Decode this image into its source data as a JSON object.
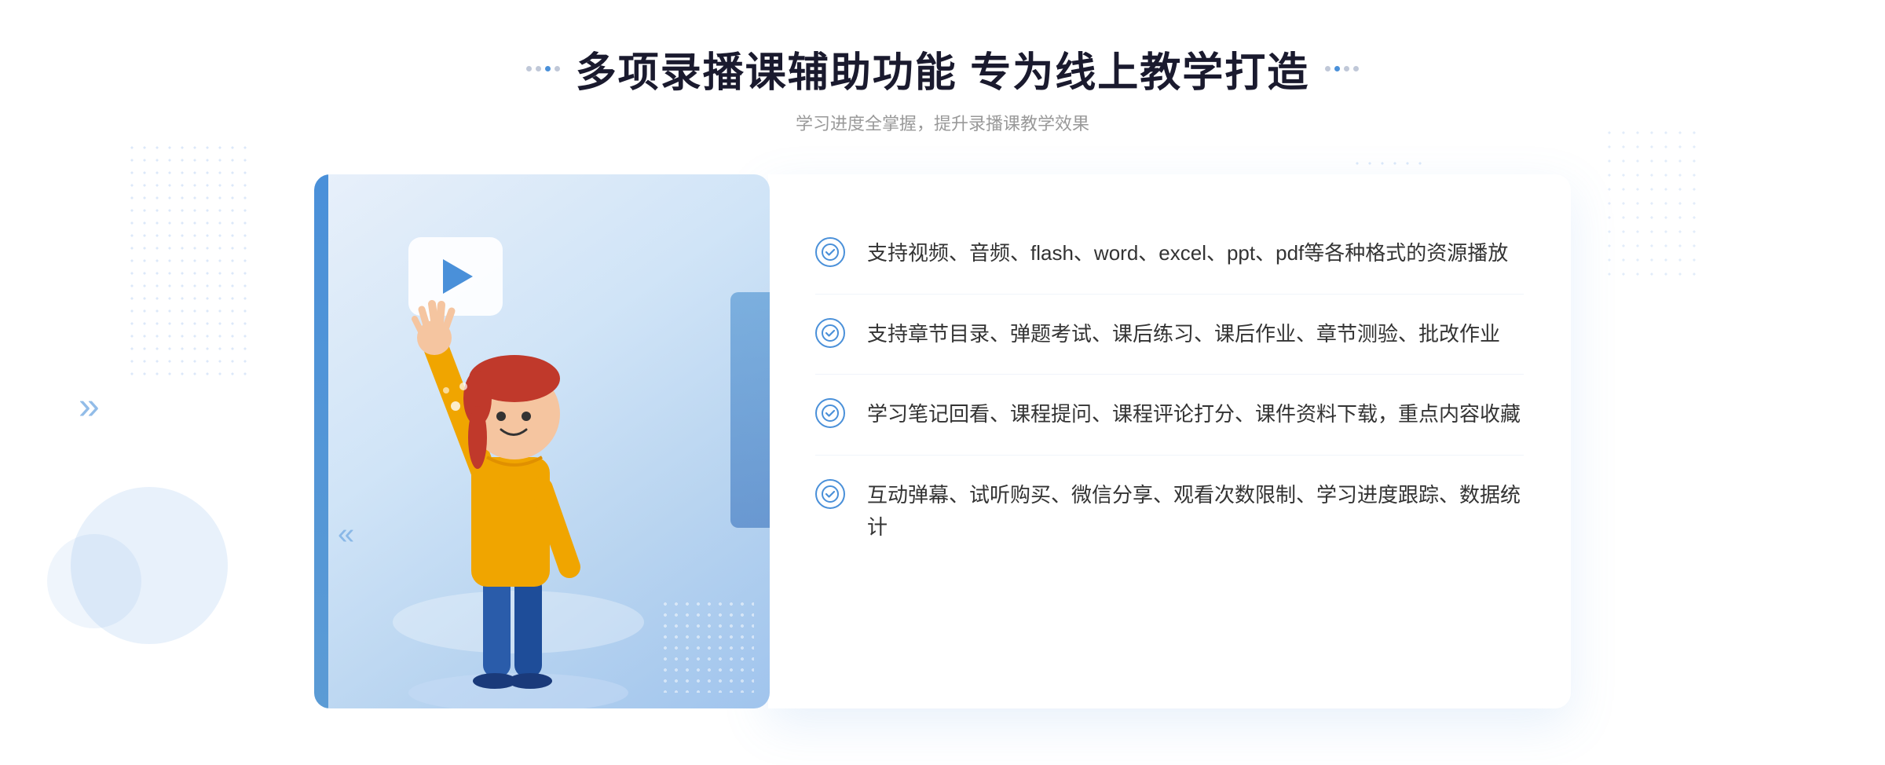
{
  "header": {
    "main_title": "多项录播课辅助功能 专为线上教学打造",
    "sub_title": "学习进度全掌握，提升录播课教学效果"
  },
  "features": [
    {
      "id": 1,
      "text": "支持视频、音频、flash、word、excel、ppt、pdf等各种格式的资源播放"
    },
    {
      "id": 2,
      "text": "支持章节目录、弹题考试、课后练习、课后作业、章节测验、批改作业"
    },
    {
      "id": 3,
      "text": "学习笔记回看、课程提问、课程评论打分、课件资料下载，重点内容收藏"
    },
    {
      "id": 4,
      "text": "互动弹幕、试听购买、微信分享、观看次数限制、学习进度跟踪、数据统计"
    }
  ],
  "icons": {
    "check": "✓",
    "play": "▶",
    "arrow_right": "»"
  },
  "colors": {
    "primary_blue": "#4a90d9",
    "light_blue": "#e8f0fa",
    "title_color": "#1a1a2e",
    "text_color": "#333333",
    "sub_text": "#999999"
  }
}
